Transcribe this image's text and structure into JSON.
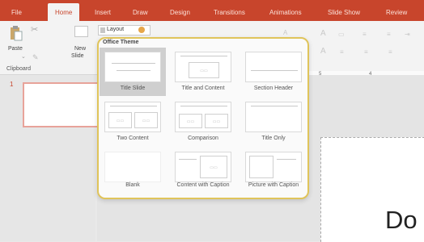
{
  "ribbon_tabs": [
    "File",
    "Home",
    "Insert",
    "Draw",
    "Design",
    "Transitions",
    "Animations",
    "Slide Show",
    "Review"
  ],
  "active_tab": "Home",
  "ribbon": {
    "paste_label": "Paste",
    "new_slide_label_1": "New",
    "new_slide_label_2": "Slide",
    "clipboard_group": "Clipboard",
    "layout_label": "Layout"
  },
  "gallery": {
    "title": "Office Theme",
    "items": [
      {
        "label": "Title Slide",
        "selected": true
      },
      {
        "label": "Title and Content",
        "selected": false
      },
      {
        "label": "Section Header",
        "selected": false
      },
      {
        "label": "Two Content",
        "selected": false
      },
      {
        "label": "Comparison",
        "selected": false
      },
      {
        "label": "Title Only",
        "selected": false
      },
      {
        "label": "Blank",
        "selected": false
      },
      {
        "label": "Content with Caption",
        "selected": false
      },
      {
        "label": "Picture with Caption",
        "selected": false
      }
    ]
  },
  "thumbnails": {
    "slide_number": "1"
  },
  "slide": {
    "visible_text": "Do"
  },
  "ruler": {
    "tick_5": "5",
    "tick_4": "4"
  },
  "colors": {
    "accent": "#c8452c",
    "gallery_border": "#e0c45a"
  }
}
